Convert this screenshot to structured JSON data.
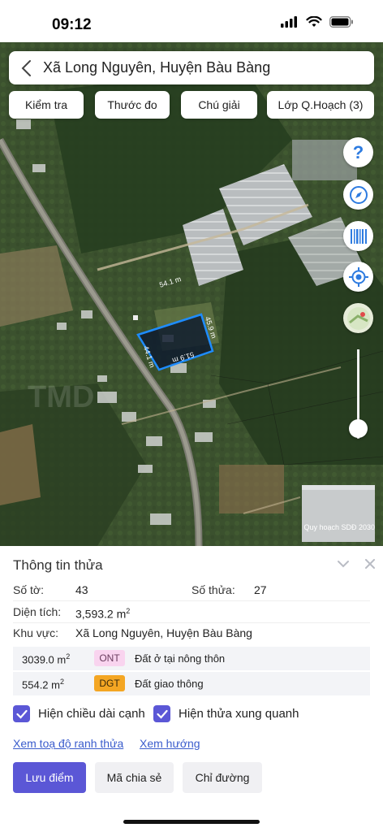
{
  "status_bar": {
    "time": "09:12"
  },
  "header": {
    "title": "Xã Long Nguyên, Huyện Bàu Bàng"
  },
  "toolbar": {
    "buttons": [
      "Kiểm tra",
      "Thước đo",
      "Chú giải",
      "Lớp Q.Hoạch (3)"
    ]
  },
  "map": {
    "parcel_labels": [
      "54.1 m",
      "45.9 m",
      "44.1 m",
      "51.9 m"
    ],
    "credit": "Quy hoạch SDĐ 2030",
    "watermark": "TMD",
    "side_buttons": [
      "help-icon",
      "compass-icon",
      "barcode-icon",
      "locate-icon",
      "map-layer-icon"
    ],
    "zoom_level": 0.8
  },
  "panel": {
    "title": "Thông tin thửa",
    "so_to_label": "Số tờ:",
    "so_to_value": "43",
    "so_thua_label": "Số thửa:",
    "so_thua_value": "27",
    "dien_tich_label": "Diện tích:",
    "dien_tich_value": "3,593.2 m",
    "dien_tich_sup": "2",
    "khu_vuc_label": "Khu vực:",
    "khu_vuc_value": "Xã Long Nguyên, Huyện Bàu Bàng",
    "land_uses": [
      {
        "area": "3039.0 m",
        "sup": "2",
        "code": "ONT",
        "name": "Đất ở tại nông thôn",
        "code_bg": "#f9d4ef",
        "code_fg": "#6a3d5e"
      },
      {
        "area": "554.2 m",
        "sup": "2",
        "code": "DGT",
        "name": "Đất giao thông",
        "code_bg": "#f4a623",
        "code_fg": "#3a2a0a"
      }
    ],
    "checkbox_edges": "Hiện chiều dài cạnh",
    "checkbox_neighbors": "Hiện thửa xung quanh",
    "link_coords": "Xem toạ độ ranh thửa",
    "link_direction": "Xem hướng",
    "btn_save": "Lưu điểm",
    "btn_share": "Mã chia sẻ",
    "btn_route": "Chỉ đường"
  },
  "colors": {
    "accent": "#5b57d6",
    "link": "#3a5ccc",
    "parcel": "#1e8cff",
    "ont": "#f9d4ef",
    "dgt": "#f4a623"
  }
}
